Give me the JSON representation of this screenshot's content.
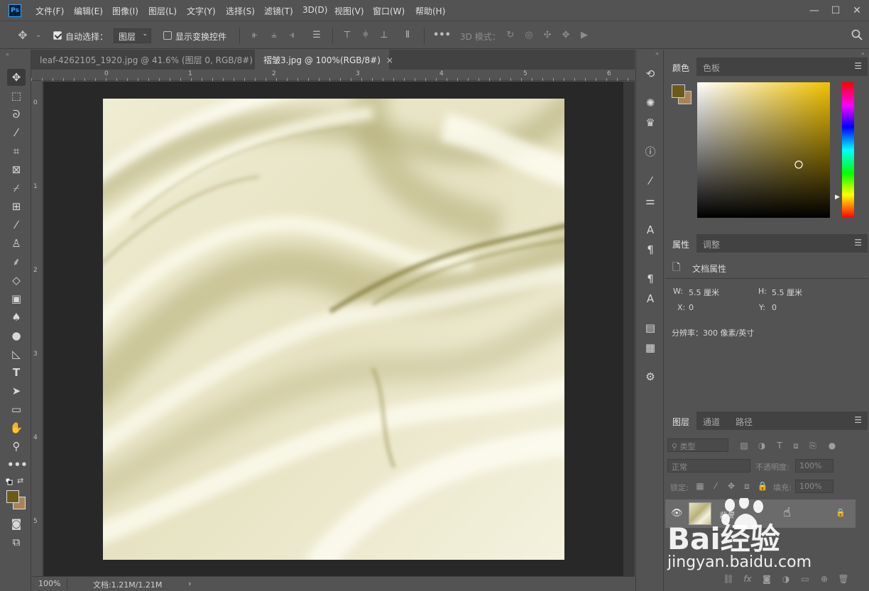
{
  "app": {
    "logo_text": "Ps",
    "menu": [
      "文件(F)",
      "编辑(E)",
      "图像(I)",
      "图层(L)",
      "文字(Y)",
      "选择(S)",
      "滤镜(T)",
      "3D(D)",
      "视图(V)",
      "窗口(W)",
      "帮助(H)"
    ],
    "window_buttons": {
      "minimize": "—",
      "maximize": "☐",
      "close": "✕"
    }
  },
  "options_bar": {
    "auto_select_label": "自动选择：",
    "auto_select_checked": true,
    "auto_select_target": "图层",
    "show_transform_label": "显示变换控件",
    "show_transform_checked": false,
    "mode_3d_label": "3D 模式："
  },
  "tabs": [
    {
      "label": "leaf-4262105_1920.jpg @ 41.6% (图层 0, RGB/8#) *",
      "close": "×",
      "active": false
    },
    {
      "label": "褶皱3.jpg @ 100%(RGB/8#)",
      "close": "×",
      "active": true
    }
  ],
  "rulers": {
    "top": [
      "0",
      "1",
      "2",
      "3",
      "4",
      "5",
      "6"
    ],
    "left": [
      "0",
      "1",
      "2",
      "3",
      "4",
      "5"
    ]
  },
  "status_bar": {
    "zoom": "100%",
    "doc_info": "文档:1.21M/1.21M",
    "arrow": "›"
  },
  "color_panel": {
    "tabs": [
      "颜色",
      "色板"
    ],
    "foreground": "#6b5a1a",
    "background": "#a8835a",
    "hue_color": "#f2c200"
  },
  "properties_panel": {
    "tabs": [
      "属性",
      "调整"
    ],
    "section_title": "文档属性",
    "w_label": "W:",
    "w_value": "5.5 厘米",
    "h_label": "H:",
    "h_value": "5.5 厘米",
    "x_label": "X:",
    "x_value": "0",
    "y_label": "Y:",
    "y_value": "0",
    "resolution": "分辨率：300 像素/英寸"
  },
  "layers_panel": {
    "tabs": [
      "图层",
      "通道",
      "路径"
    ],
    "filter_kind": "类型",
    "blend_mode": "正常",
    "opacity_label": "不透明度:",
    "opacity_value": "100%",
    "lock_label": "锁定:",
    "fill_label": "填充:",
    "fill_value": "100%",
    "layer_name": "背景"
  },
  "watermark": {
    "brand": "Bai经验",
    "url": "jingyan.baidu.com"
  }
}
